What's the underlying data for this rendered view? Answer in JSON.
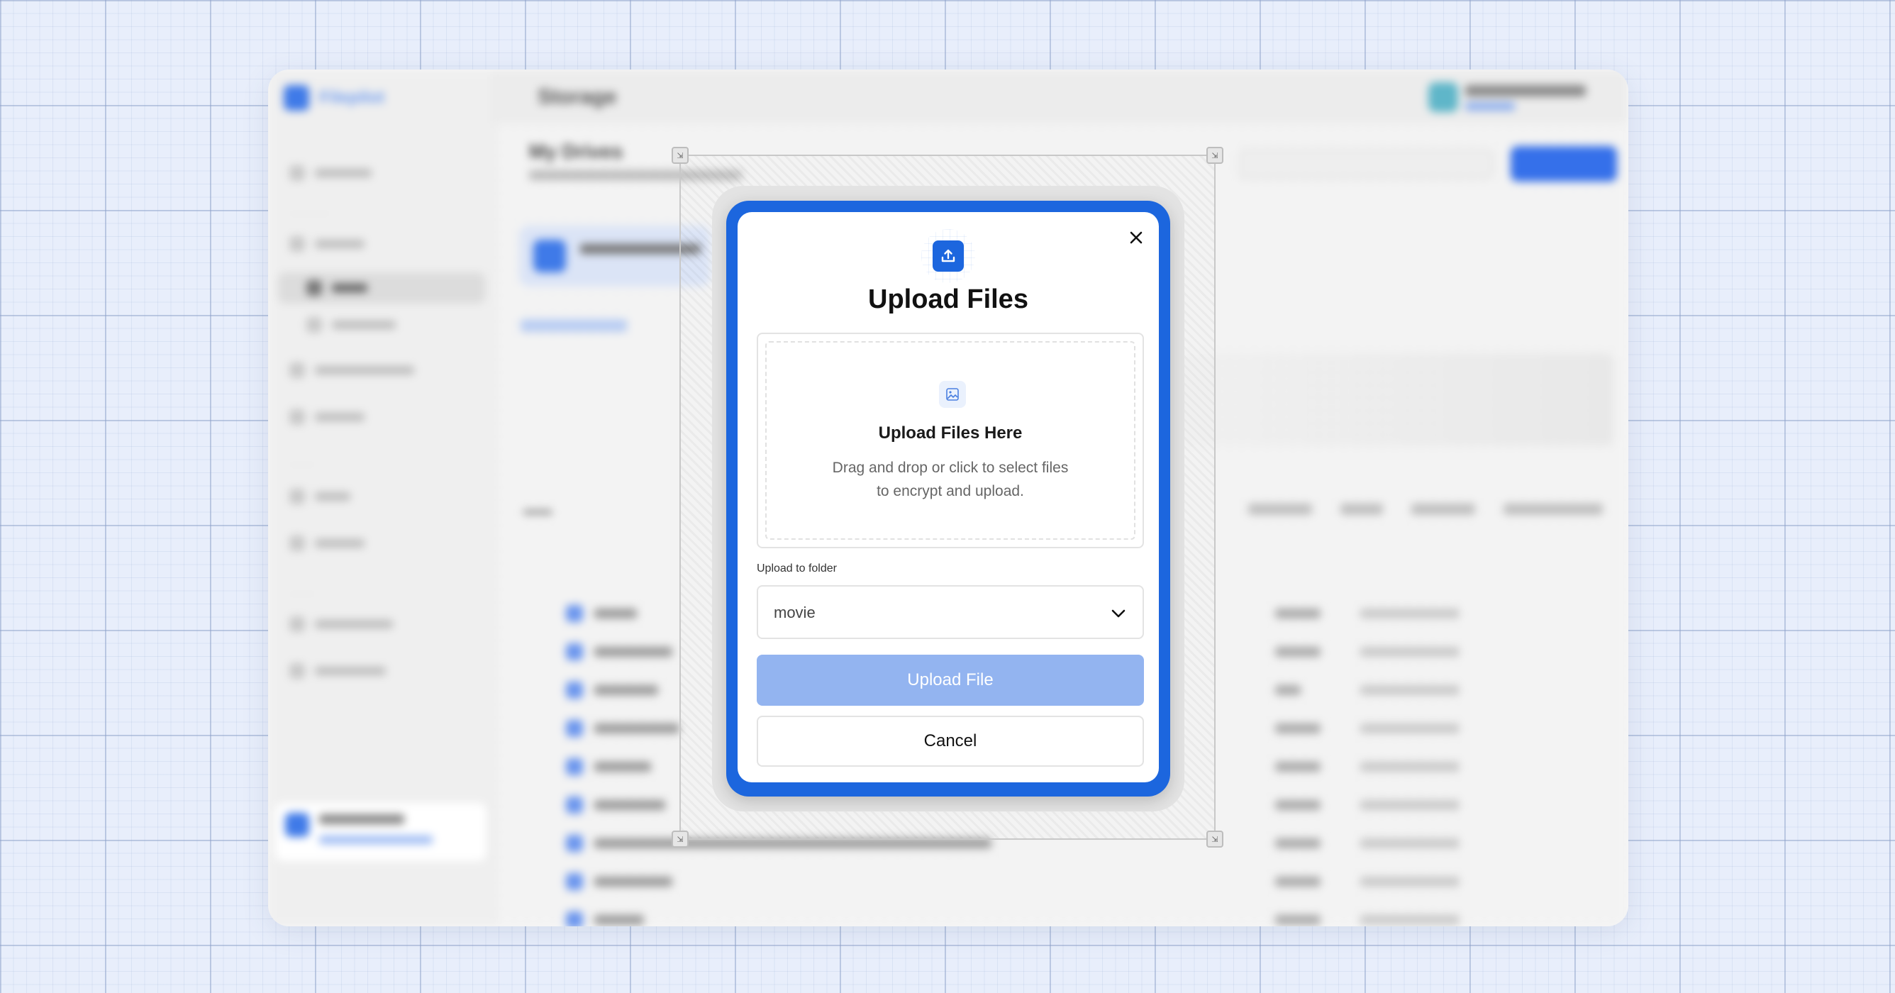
{
  "background_app": {
    "logo_text": "Filepilot",
    "page_title": "Storage",
    "heading": "My Drives"
  },
  "modal": {
    "title": "Upload Files",
    "dropzone": {
      "title": "Upload Files Here",
      "description": "Drag and drop or click to select files to encrypt and upload."
    },
    "folder_label": "Upload to folder",
    "folder_value": "movie",
    "upload_button": "Upload File",
    "cancel_button": "Cancel",
    "accent_color": "#1c66de",
    "disabled_button_color": "#93b4f0"
  },
  "icons": {
    "upload": "upload-icon",
    "close": "close-icon",
    "image": "image-upload-icon",
    "chevron": "chevron-down-icon"
  }
}
